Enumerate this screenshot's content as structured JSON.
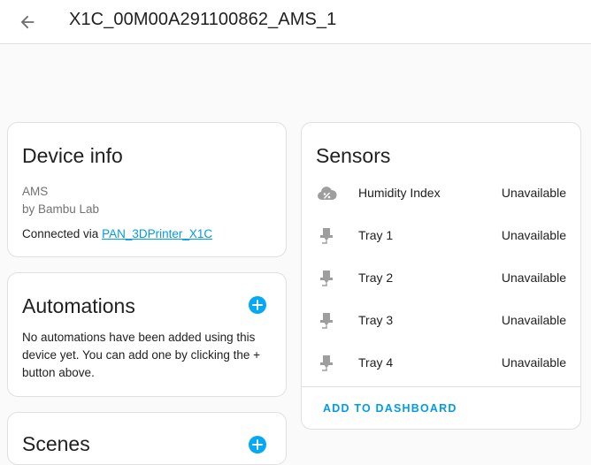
{
  "header": {
    "title": "X1C_00M00A291100862_AMS_1"
  },
  "device_info": {
    "title": "Device info",
    "model": "AMS",
    "manufacturer": "by Bambu Lab",
    "connected_prefix": "Connected via ",
    "connected_link": "PAN_3DPrinter_X1C"
  },
  "automations": {
    "title": "Automations",
    "empty_text": "No automations have been added using this device yet. You can add one by clicking the + button above."
  },
  "scenes": {
    "title": "Scenes"
  },
  "sensors": {
    "title": "Sensors",
    "items": [
      {
        "name": "Humidity Index",
        "state": "Unavailable",
        "icon": "humidity-icon"
      },
      {
        "name": "Tray 1",
        "state": "Unavailable",
        "icon": "tray-icon"
      },
      {
        "name": "Tray 2",
        "state": "Unavailable",
        "icon": "tray-icon"
      },
      {
        "name": "Tray 3",
        "state": "Unavailable",
        "icon": "tray-icon"
      },
      {
        "name": "Tray 4",
        "state": "Unavailable",
        "icon": "tray-icon"
      }
    ],
    "action_label": "ADD TO DASHBOARD"
  },
  "colors": {
    "accent": "#03a9f4",
    "link": "#039be5",
    "icon_disabled": "#9e9e9e"
  }
}
